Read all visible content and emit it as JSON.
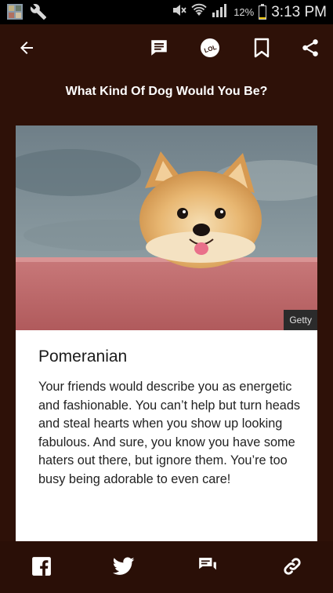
{
  "status_bar": {
    "battery_percent": "12%",
    "time": "3:13 PM",
    "icons": [
      "photo-notification-icon",
      "wrench-icon",
      "mute-icon",
      "wifi-icon",
      "signal-icon",
      "battery-icon"
    ]
  },
  "app_bar": {
    "icons": [
      "back-arrow-icon",
      "comments-icon",
      "lol-reaction-icon",
      "bookmark-icon",
      "share-icon"
    ]
  },
  "quiz": {
    "title": "What Kind Of Dog Would You Be?"
  },
  "result": {
    "image_credit": "Getty",
    "name": "Pomeranian",
    "description": "Your friends would describe you as energetic and fashionable. You can’t help but turn heads and steal hearts when you show up looking fabulous. And sure, you know you have some haters out there, but ignore them. You’re too busy being adorable to even care!"
  },
  "footer": {
    "icons": [
      "facebook-icon",
      "twitter-icon",
      "comment-icon",
      "copy-link-icon"
    ]
  },
  "colors": {
    "background": "#2e1108",
    "footer": "#2a0f07",
    "card": "#ffffff",
    "battery_fill": "#e7c000"
  }
}
